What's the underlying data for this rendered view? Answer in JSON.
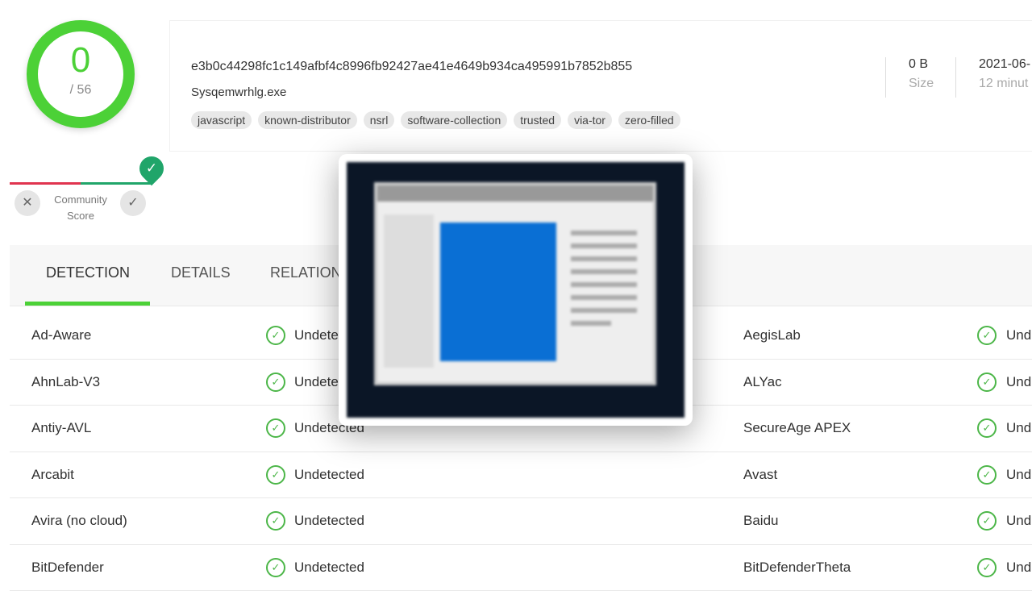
{
  "score": {
    "detections": "0",
    "total": "/ 56",
    "color": "#4cd137"
  },
  "file": {
    "hash": "e3b0c44298fc1c149afbf4c8996fb92427ae41e4649b934ca495991b7852b855",
    "name": "Sysqemwrhlg.exe",
    "tags": [
      "javascript",
      "known-distributor",
      "nsrl",
      "software-collection",
      "trusted",
      "via-tor",
      "zero-filled"
    ],
    "size": "0 B",
    "size_label": "Size",
    "date": "2021-06-",
    "date_sub": "12 minut"
  },
  "community": {
    "label": "Community Score",
    "down": "✕",
    "up": "✓"
  },
  "tabs": [
    "DETECTION",
    "DETAILS",
    "RELATION"
  ],
  "rows": [
    {
      "left": "Ad-Aware",
      "left_status": "Undete",
      "right": "AegisLab",
      "right_status": "Und"
    },
    {
      "left": "AhnLab-V3",
      "left_status": "Undete",
      "right": "ALYac",
      "right_status": "Und"
    },
    {
      "left": "Antiy-AVL",
      "left_status": "Undetected",
      "right": "SecureAge APEX",
      "right_status": "Und"
    },
    {
      "left": "Arcabit",
      "left_status": "Undetected",
      "right": "Avast",
      "right_status": "Und"
    },
    {
      "left": "Avira (no cloud)",
      "left_status": "Undetected",
      "right": "Baidu",
      "right_status": "Und"
    },
    {
      "left": "BitDefender",
      "left_status": "Undetected",
      "right": "BitDefenderTheta",
      "right_status": "Und"
    }
  ]
}
